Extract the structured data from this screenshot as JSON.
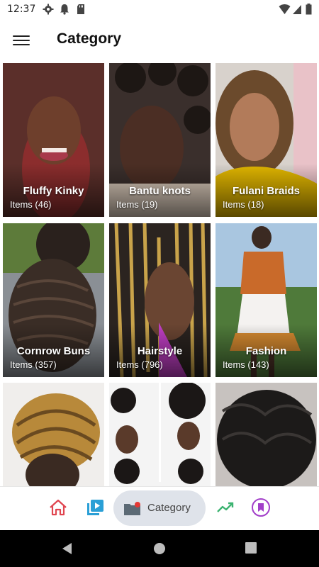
{
  "status_bar": {
    "time": "12:37",
    "left_icons": [
      "gear-icon",
      "bell-icon",
      "sd-card-icon"
    ],
    "right_icons": [
      "wifi-icon",
      "signal-icon",
      "battery-icon"
    ]
  },
  "app_bar": {
    "menu_icon": "hamburger-menu-icon",
    "title": "Category"
  },
  "categories": [
    {
      "name": "Fluffy Kinky",
      "count": "Items (46)"
    },
    {
      "name": "Bantu knots",
      "count": "Items (19)"
    },
    {
      "name": "Fulani Braids",
      "count": "Items (18)"
    },
    {
      "name": "Cornrow Buns",
      "count": "Items (357)"
    },
    {
      "name": "Hairstyle",
      "count": "Items (796)"
    },
    {
      "name": "Fashion",
      "count": "Items (143)"
    },
    {
      "name": "",
      "count": ""
    },
    {
      "name": "",
      "count": ""
    },
    {
      "name": "",
      "count": ""
    }
  ],
  "bottom_nav": {
    "items": [
      {
        "icon": "home-icon",
        "color": "#e0454f"
      },
      {
        "icon": "video-library-icon",
        "color": "#2a9fd6"
      },
      {
        "icon": "folder-icon",
        "label": "Category",
        "color": "#5c6a75",
        "badge_color": "#e53935",
        "active": true
      },
      {
        "icon": "trending-up-icon",
        "color": "#3cb371"
      },
      {
        "icon": "bookmark-icon",
        "color": "#a23fc9"
      }
    ],
    "active_bg": "#dfe3ea"
  },
  "system_nav": [
    "back-icon",
    "home-circle-icon",
    "recents-icon"
  ]
}
